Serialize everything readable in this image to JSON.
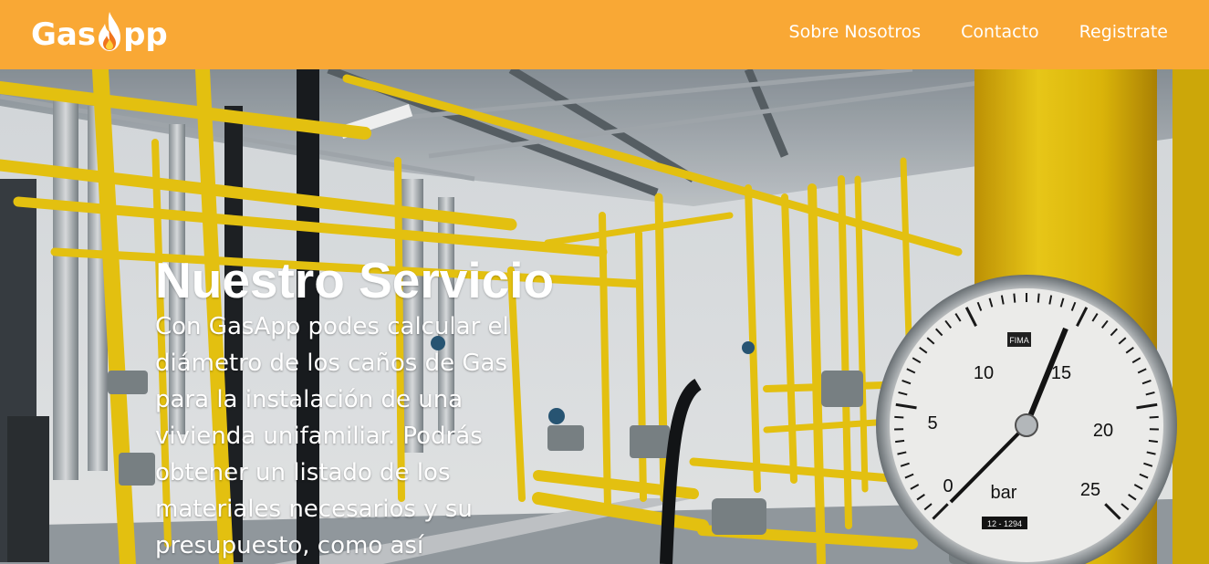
{
  "brand": {
    "name_before": "Gas",
    "name_after": "pp",
    "logo_icon": "flame-icon"
  },
  "nav": {
    "items": [
      {
        "label": "Sobre Nosotros"
      },
      {
        "label": "Contacto"
      },
      {
        "label": "Registrate"
      }
    ]
  },
  "hero": {
    "title": "Nuestro Servicio",
    "description": "Con GasApp podes calcular el diámetro de los caños de Gas para la instalación de una vivienda unifamiliar. Podrás obtener un listado de los materiales necesarios y su presupuesto, como así",
    "gauge": {
      "ticks": [
        "0",
        "5",
        "10",
        "15",
        "20",
        "25"
      ],
      "unit": "bar",
      "brand": "FIMA",
      "serial": "12 - 1294"
    }
  },
  "colors": {
    "navbar": "#f9a835",
    "pipe_yellow": "#f2cc12",
    "text": "#ffffff"
  }
}
